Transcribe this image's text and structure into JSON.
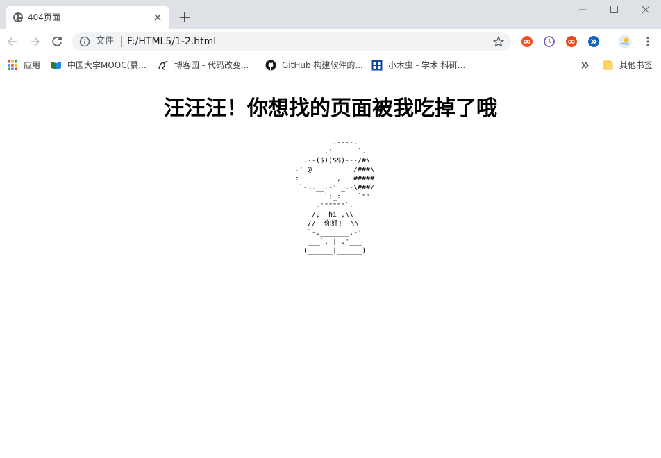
{
  "tab": {
    "title": "404页面"
  },
  "toolbar": {
    "scheme_label": "文件",
    "url": "F:/HTML5/1-2.html"
  },
  "bookmarks": [
    {
      "label": "应用",
      "icon": "apps-grid-icon"
    },
    {
      "label": "中国大学MOOC(慕...",
      "icon": "mooc-icon"
    },
    {
      "label": "博客园 - 代码改变...",
      "icon": "cnblogs-icon"
    },
    {
      "label": "GitHub·构建软件的...",
      "icon": "github-icon"
    },
    {
      "label": "小木虫 - 学术 科研...",
      "icon": "xiaomuchong-icon"
    }
  ],
  "other_bookmarks": {
    "label": "其他书签",
    "icon": "folder-icon"
  },
  "page": {
    "heading": "汪汪汪！你想找的页面被我吃掉了哦",
    "ascii_art": "           .----.\n        _.'__    `.\n    .--($)($$)---/#\\\n  .' @          /###\\\n  :         ,   #####\n   `-..__.-' _.-\\###/\n         `;_:    `\"'\n       .'\"\"\"\"\"`.\n      /,  hi ,\\\\\n     //  你好!  \\\\\n     `-._______.-'\n     ___`. | .'___\n    (______|______)"
  },
  "colors": {
    "tabstrip": "#dee1e6",
    "omnibox": "#f1f3f4",
    "text": "#202124"
  }
}
